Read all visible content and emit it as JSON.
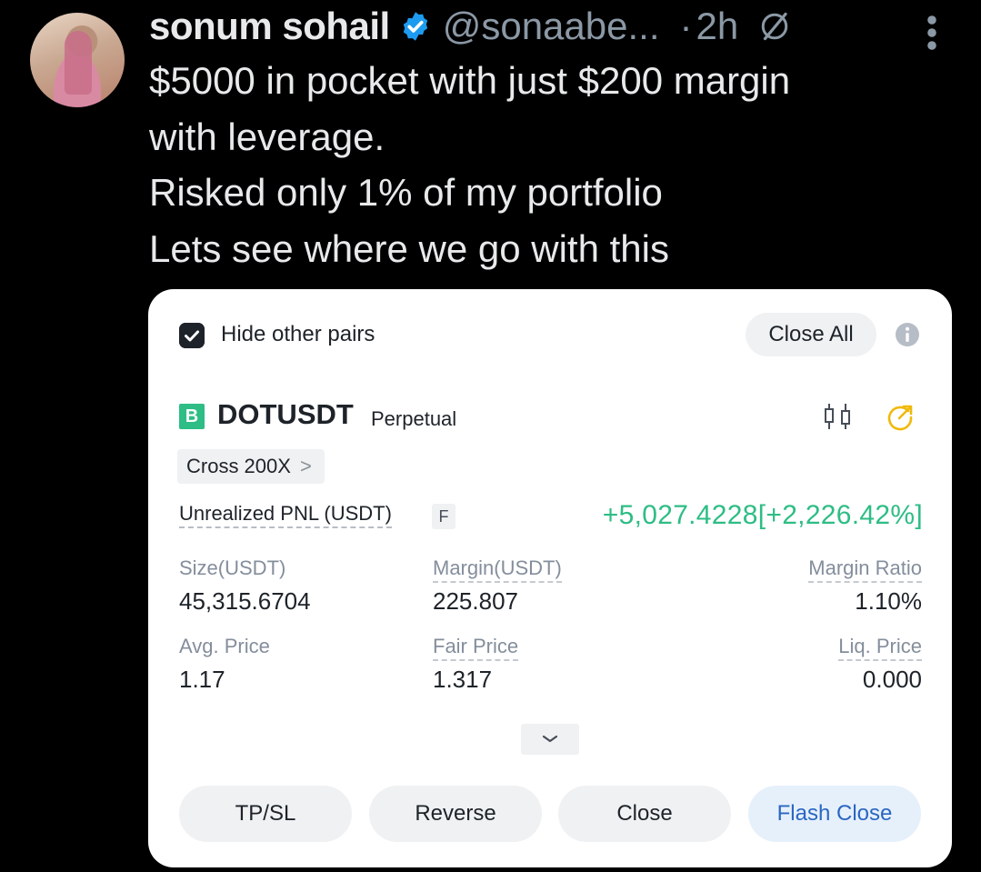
{
  "tweet": {
    "author_name": "sonum sohail",
    "handle": "@sonaabe...",
    "dot": "·",
    "time": "2h",
    "text_lines": [
      "$5000 in pocket with just $200 margin",
      "with leverage.",
      "Risked only 1% of my portfolio",
      "Lets see where we go with this"
    ]
  },
  "card": {
    "hide_other_pairs": "Hide other pairs",
    "close_all": "Close All",
    "badge": "B",
    "symbol": "DOTUSDT",
    "contract_type": "Perpetual",
    "margin_mode": "Cross 200X",
    "margin_mode_chevron": ">",
    "pnl_label": "Unrealized PNL (USDT)",
    "pnl_badge": "F",
    "pnl_value": "+5,027.4228[+2,226.42%]",
    "stats": {
      "size_label": "Size(USDT)",
      "size_value": "45,315.6704",
      "margin_label": "Margin(USDT)",
      "margin_value": "225.807",
      "margin_ratio_label": "Margin Ratio",
      "margin_ratio_value": "1.10%",
      "avg_price_label": "Avg. Price",
      "avg_price_value": "1.17",
      "fair_price_label": "Fair Price",
      "fair_price_value": "1.317",
      "liq_price_label": "Liq. Price",
      "liq_price_value": "0.000"
    },
    "buttons": {
      "tpsl": "TP/SL",
      "reverse": "Reverse",
      "close": "Close",
      "flash_close": "Flash Close"
    }
  },
  "colors": {
    "background": "#000000",
    "verified_blue": "#1d9bf0",
    "profit_green": "#2ebd85",
    "share_orange": "#f0b90b",
    "flash_blue": "#2a66c2"
  },
  "icons": [
    "verified-badge-icon",
    "grok-icon",
    "more-icon",
    "checkbox-checked-icon",
    "info-icon",
    "candlestick-icon",
    "share-icon",
    "chevron-down-icon"
  ]
}
